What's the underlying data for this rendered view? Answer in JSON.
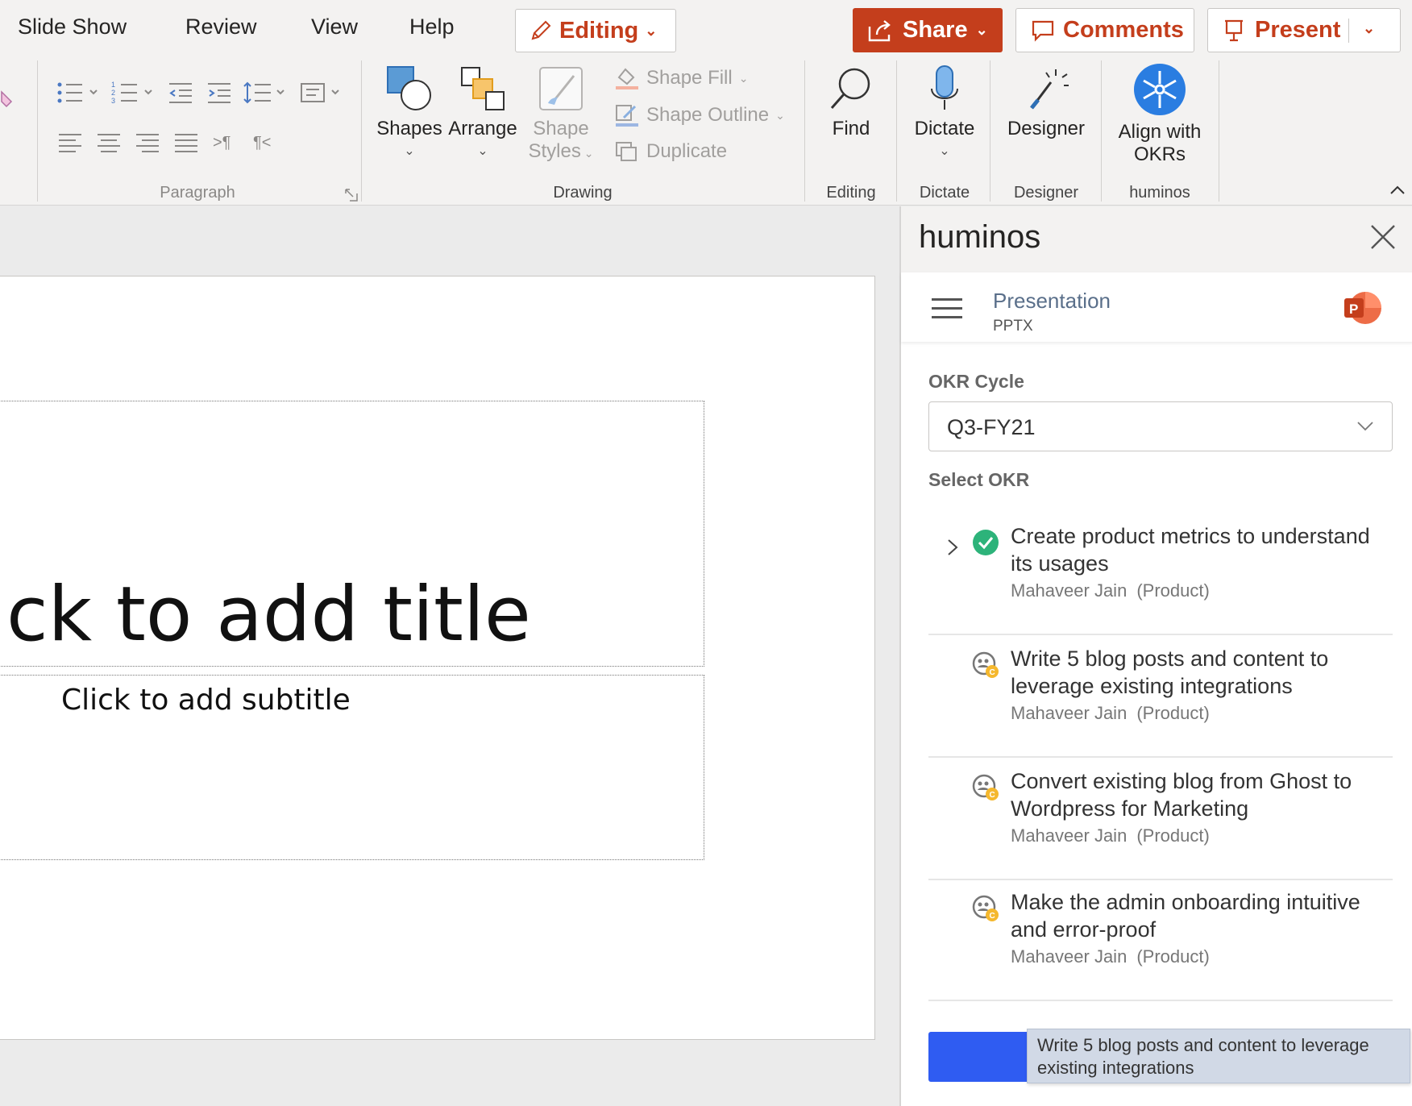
{
  "menu": {
    "tabs": [
      "Slide Show",
      "Review",
      "View",
      "Help"
    ],
    "editing_label": "Editing",
    "share_label": "Share",
    "comments_label": "Comments",
    "present_label": "Present"
  },
  "ribbon": {
    "groups": {
      "paragraph": "Paragraph",
      "drawing": "Drawing",
      "editing": "Editing",
      "dictate": "Dictate",
      "designer": "Designer",
      "huminos": "huminos"
    },
    "buttons": {
      "shapes": "Shapes",
      "arrange": "Arrange",
      "shape_styles_1": "Shape",
      "shape_styles_2": "Styles",
      "shape_fill": "Shape Fill",
      "shape_outline": "Shape Outline",
      "duplicate": "Duplicate",
      "find": "Find",
      "dictate": "Dictate",
      "designer": "Designer",
      "align_okrs_1": "Align with",
      "align_okrs_2": "OKRs"
    }
  },
  "slide": {
    "title_placeholder": "ck to add title",
    "subtitle_placeholder": "Click to add subtitle"
  },
  "pane": {
    "title": "huminos",
    "document_name": "Presentation",
    "document_type": "PPTX",
    "okr_cycle_label": "OKR Cycle",
    "okr_cycle_value": "Q3-FY21",
    "select_okr_label": "Select OKR",
    "okrs": [
      {
        "title": "Create product metrics to understand its usages",
        "owner": "Mahaveer Jain",
        "dept": "(Product)",
        "status": "complete"
      },
      {
        "title": "Write 5 blog posts and content to leverage existing integrations",
        "owner": "Mahaveer Jain",
        "dept": "(Product)",
        "status": "in-progress"
      },
      {
        "title": "Convert existing blog from Ghost to Wordpress for Marketing",
        "owner": "Mahaveer Jain",
        "dept": "(Product)",
        "status": "in-progress"
      },
      {
        "title": "Make the admin onboarding intuitive and error-proof",
        "owner": "Mahaveer Jain",
        "dept": "(Product)",
        "status": "in-progress"
      }
    ],
    "tooltip": "Write 5 blog posts and content to leverage existing integrations"
  },
  "colors": {
    "accent": "#c43e1c",
    "primary_button": "#2f5cf2",
    "complete_green": "#2db37a",
    "progress_yellow": "#f5b82e",
    "huminos_blue": "#2a7de1"
  }
}
